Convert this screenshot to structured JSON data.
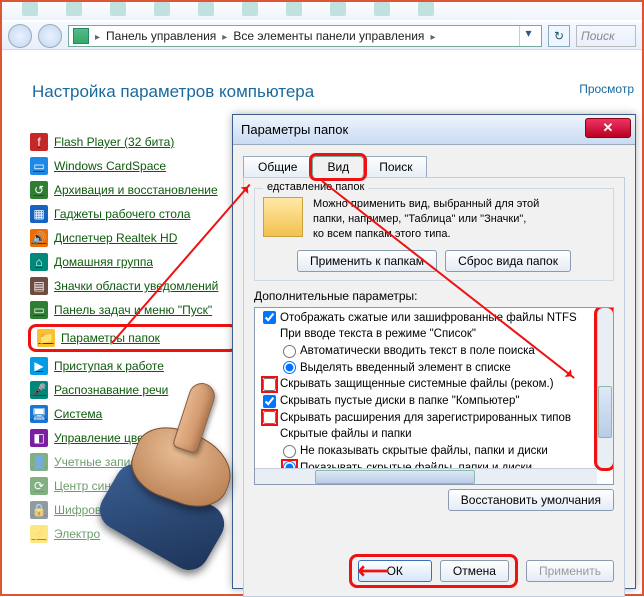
{
  "breadcrumb": {
    "seg1": "Панель управления",
    "seg2": "Все элементы панели управления",
    "search_placeholder": "Поиск"
  },
  "cp": {
    "heading": "Настройка параметров компьютера",
    "view_label": "Просмотр",
    "items": [
      {
        "label": "Flash Player (32 бита)",
        "ico_bg": "#c62828",
        "ico_txt": "f"
      },
      {
        "label": "Windows CardSpace",
        "ico_bg": "#1e88e5",
        "ico_txt": "▭"
      },
      {
        "label": "Архивация и восстановление",
        "ico_bg": "#2e7d32",
        "ico_txt": "↺"
      },
      {
        "label": "Гаджеты рабочего стола",
        "ico_bg": "#1565c0",
        "ico_txt": "▦"
      },
      {
        "label": "Диспетчер Realtek HD",
        "ico_bg": "#ef6c00",
        "ico_txt": "🔊"
      },
      {
        "label": "Домашняя группа",
        "ico_bg": "#00897b",
        "ico_txt": "⌂"
      },
      {
        "label": "Значки области уведомлений",
        "ico_bg": "#6d4c41",
        "ico_txt": "▤"
      },
      {
        "label": "Панель задач и меню \"Пуск\"",
        "ico_bg": "#2e7d32",
        "ico_txt": "▭"
      },
      {
        "label": "Параметры папок",
        "ico_bg": "#fbc02d",
        "ico_txt": "📁",
        "selected": true
      },
      {
        "label": "Приступая к работе",
        "ico_bg": "#039be5",
        "ico_txt": "▶"
      },
      {
        "label": "Распознавание речи",
        "ico_bg": "#00897b",
        "ico_txt": "🎤"
      },
      {
        "label": "Система",
        "ico_bg": "#1976d2",
        "ico_txt": "🖥"
      },
      {
        "label": "Управление цветом",
        "ico_bg": "#7b1fa2",
        "ico_txt": "◧"
      },
      {
        "label": "Учетные записи",
        "ico_bg": "#2e7d32",
        "ico_txt": "👤",
        "faded": true
      },
      {
        "label": "Центр синхро",
        "ico_bg": "#2e7d32",
        "ico_txt": "⟳",
        "faded": true
      },
      {
        "label": "Шифрован",
        "ico_bg": "#455a64",
        "ico_txt": "🔒",
        "faded": true
      },
      {
        "label": "Электро",
        "ico_bg": "#fdd835",
        "ico_txt": "⚡",
        "faded": true
      }
    ]
  },
  "dialog": {
    "title": "Параметры папок",
    "tabs": {
      "general": "Общие",
      "view": "Вид",
      "search": "Поиск"
    },
    "folder_group_label": "едставление папок",
    "folder_desc_l1": "Можно применить вид, выбранный для этой",
    "folder_desc_l2": "папки, например, \"Таблица\" или \"Значки\",",
    "folder_desc_l3": "ко всем папкам этого типа.",
    "btn_apply_to": "Применить к папкам",
    "btn_reset_view": "Сброс вида папок",
    "adv_label": "Дополнительные параметры:",
    "tree": {
      "nti": "Отображать сжатые или зашифрованные файлы NTFS",
      "list_mode": "При вводе текста в режиме \"Список\"",
      "auto_type": "Автоматически вводить текст в поле поиска",
      "highlight": "Выделять введенный элемент в списке",
      "hide_protected": "Скрывать защищенные системные файлы (реком.)",
      "hide_empty": "Скрывать пустые диски в папке \"Компьютер\"",
      "hide_ext": "Скрывать расширения для зарегистрированных типов",
      "hidden_folder": "Скрытые файлы и папки",
      "dont_show": "Не показывать скрытые файлы, папки и диски",
      "show_hidden": "Показывать скрытые файлы, папки и диски"
    },
    "btn_restore": "Восстановить умолчания",
    "btn_ok": "ОК",
    "btn_cancel": "Отмена",
    "btn_apply": "Применить"
  }
}
